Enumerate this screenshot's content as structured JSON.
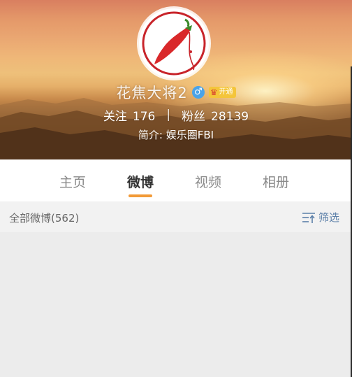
{
  "profile": {
    "username": "花焦大将2",
    "vip_label": "开通",
    "following_label": "关注",
    "following_count": "176",
    "followers_label": "粉丝",
    "followers_count": "28139",
    "bio": "简介: 娱乐圈FBI"
  },
  "tabs": [
    {
      "label": "主页",
      "active": false
    },
    {
      "label": "微博",
      "active": true
    },
    {
      "label": "视频",
      "active": false
    },
    {
      "label": "相册",
      "active": false
    }
  ],
  "filter_bar": {
    "all_posts": "全部微博(562)",
    "filter_label": "筛选"
  },
  "colors": {
    "tab_accent": "#f29a38",
    "filter_link": "#5b7fa8",
    "gender_badge": "#4aa3e8",
    "vip_badge": "#f4c53a"
  }
}
